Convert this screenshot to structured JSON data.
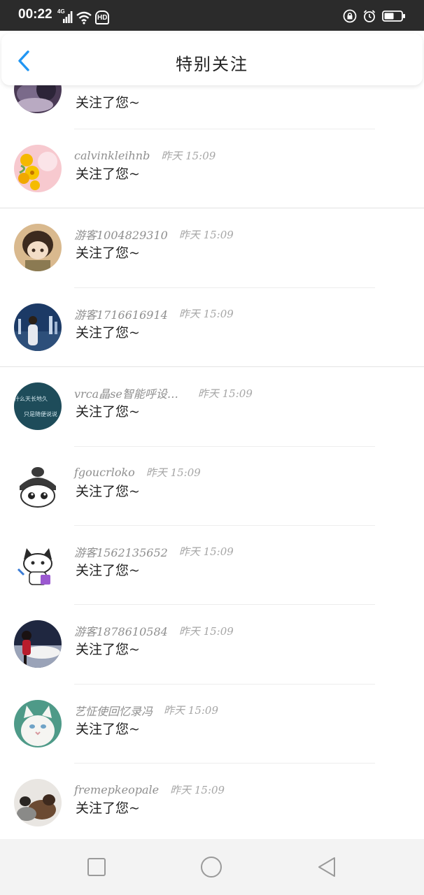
{
  "status_bar": {
    "time": "00:22",
    "network": "4G",
    "wifi_label": "HD",
    "icons": [
      "signal-icon",
      "wifi-icon",
      "hd-icon",
      "lock-icon",
      "alarm-icon",
      "battery-icon"
    ]
  },
  "header": {
    "title": "特别关注",
    "back_icon": "chevron-left-icon",
    "accent_color": "#2196f3"
  },
  "list": {
    "items": [
      {
        "name": "",
        "time": "",
        "message": "关注了您~",
        "avatar": "avatar-dark-blur"
      },
      {
        "name": "calvinkleihnb",
        "time": "昨天 15:09",
        "message": "关注了您~",
        "avatar": "avatar-flowers"
      },
      {
        "name": "游客1004829310",
        "time": "昨天 15:09",
        "message": "关注了您~",
        "avatar": "avatar-anime-boy"
      },
      {
        "name": "游客1716616914",
        "time": "昨天 15:09",
        "message": "关注了您~",
        "avatar": "avatar-city-night"
      },
      {
        "name": "vrca晶se智能呼设…",
        "time": "昨天 15:09",
        "message": "关注了您~",
        "avatar": "avatar-text-teal",
        "avatar_text": [
          "什么天长地久",
          "只是随便说说"
        ]
      },
      {
        "name": "fgoucrloko",
        "time": "昨天 15:09",
        "message": "关注了您~",
        "avatar": "avatar-cartoon-face"
      },
      {
        "name": "游客1562135652",
        "time": "昨天 15:09",
        "message": "关注了您~",
        "avatar": "avatar-cartoon-cat"
      },
      {
        "name": "游客1878610584",
        "time": "昨天 15:09",
        "message": "关注了您~",
        "avatar": "avatar-car-girl"
      },
      {
        "name": "艺怔使回忆录冯",
        "time": "昨天 15:09",
        "message": "关注了您~",
        "avatar": "avatar-white-cat"
      },
      {
        "name": "fremepkeopale",
        "time": "昨天 15:09",
        "message": "关注了您~",
        "avatar": "avatar-dog"
      }
    ]
  },
  "nav_bar": {
    "buttons": [
      "recents-square-icon",
      "home-circle-icon",
      "back-triangle-icon"
    ]
  }
}
